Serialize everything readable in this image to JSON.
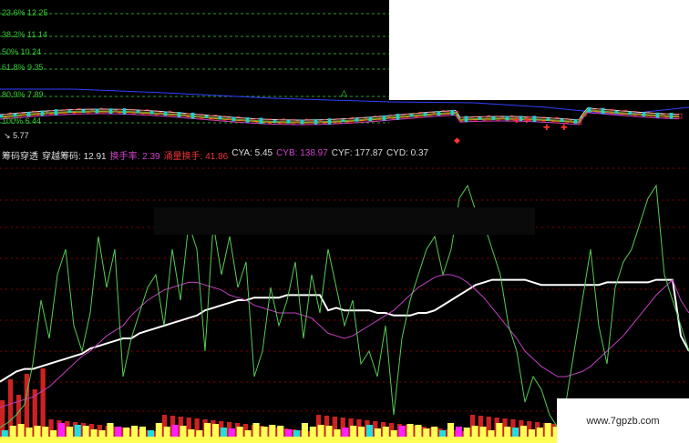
{
  "fib_levels": [
    {
      "label": "23.6% 12.25"
    },
    {
      "label": "38.2% 11.14"
    },
    {
      "label": "50% 10.24"
    },
    {
      "label": "61.8% 9.35"
    },
    {
      "label": "80.9% 7.89"
    },
    {
      "label": "100% 6.44"
    }
  ],
  "low_price_label": "5.77",
  "indicator_header": {
    "name": "筹码穿透",
    "series": [
      {
        "label": "穿越筹码",
        "value": "12.91",
        "color": "#dddddd"
      },
      {
        "label": "换手率",
        "value": "2.39",
        "color": "#cc44cc"
      },
      {
        "label": "涌量换手",
        "value": "41.86",
        "color": "#ee3333"
      },
      {
        "label": "CYA",
        "value": "5.45",
        "color": "#dddddd"
      },
      {
        "label": "CYB",
        "value": "138.97",
        "color": "#cc44cc"
      },
      {
        "label": "CYF",
        "value": "177.87",
        "color": "#dddddd"
      },
      {
        "label": "CYD",
        "value": "0.37",
        "color": "#dddddd"
      }
    ]
  },
  "watermark": "www.7gpzb.com",
  "colors": {
    "background": "#000000",
    "grid": "#8b0000",
    "fib_line": "#2e9e2e",
    "green_line": "#55cc55",
    "white_line": "#ffffff",
    "magenta_line": "#c040c0",
    "bar_red": "#cc2222",
    "bar_yellow": "#ffff55",
    "bar_cyan": "#22dddd",
    "bar_magenta": "#ff22ff"
  },
  "chart_data": {
    "type": "line",
    "series": [
      {
        "name": "穿越筹码",
        "color": "#ffffff",
        "y": [
          18,
          20,
          22,
          23,
          23,
          24,
          25,
          26,
          27,
          28,
          29,
          31,
          32,
          33,
          34,
          35,
          35,
          37,
          38,
          39,
          40,
          41,
          42,
          43,
          44,
          46,
          47,
          48,
          49,
          50,
          50,
          51,
          51,
          51,
          51,
          52,
          52,
          52,
          52,
          52,
          46,
          47,
          46,
          46,
          46,
          46,
          45,
          45,
          44,
          44,
          44,
          45,
          45,
          46,
          48,
          50,
          52,
          54,
          56,
          57,
          58,
          58,
          58,
          58,
          58,
          57,
          56,
          56,
          56,
          56,
          56,
          56,
          56,
          56,
          57,
          57,
          57,
          57,
          57,
          57,
          58,
          58,
          58,
          36,
          30
        ]
      },
      {
        "name": "换手率",
        "color": "#c040c0",
        "y": [
          8,
          9,
          10,
          11,
          12,
          14,
          16,
          19,
          22,
          25,
          28,
          30,
          33,
          36,
          38,
          40,
          44,
          47,
          50,
          52,
          54,
          55,
          56,
          57,
          57,
          56,
          55,
          54,
          52,
          51,
          50,
          48,
          47,
          46,
          45,
          45,
          45,
          44,
          43,
          40,
          37,
          36,
          35,
          36,
          38,
          40,
          42,
          44,
          46,
          49,
          52,
          55,
          57,
          59,
          60,
          60,
          59,
          57,
          54,
          51,
          47,
          43,
          39,
          35,
          30,
          27,
          24,
          22,
          20,
          20,
          21,
          22,
          24,
          27,
          30,
          33,
          36,
          40,
          44,
          48,
          52,
          55,
          58,
          50,
          45
        ]
      },
      {
        "name": "CYA",
        "color": "#55cc55",
        "y": [
          0,
          2,
          5,
          9,
          25,
          50,
          35,
          60,
          70,
          40,
          30,
          45,
          75,
          55,
          70,
          20,
          35,
          45,
          55,
          60,
          40,
          70,
          50,
          80,
          70,
          30,
          80,
          60,
          75,
          55,
          65,
          20,
          30,
          55,
          40,
          50,
          65,
          35,
          60,
          45,
          70,
          55,
          40,
          50,
          25,
          30,
          20,
          40,
          5,
          35,
          50,
          60,
          70,
          75,
          60,
          70,
          90,
          95,
          85,
          80,
          70,
          60,
          40,
          30,
          10,
          20,
          15,
          5,
          0,
          10,
          30,
          50,
          70,
          40,
          25,
          55,
          65,
          70,
          80,
          90,
          95,
          60,
          50,
          40,
          30
        ]
      }
    ],
    "bars": [
      1,
      1,
      2,
      1,
      2,
      2,
      1,
      2,
      1,
      2,
      2,
      1,
      1,
      2,
      1,
      1,
      2,
      2,
      1,
      2,
      1,
      2,
      2,
      1,
      1,
      2,
      2,
      1,
      1,
      2,
      1,
      2,
      1,
      2,
      2,
      1,
      1,
      2,
      1,
      2,
      2,
      1,
      2,
      1,
      1,
      2,
      1,
      2,
      1,
      1,
      2,
      2,
      1,
      2,
      1,
      2,
      1,
      1,
      2,
      2,
      1,
      2,
      1,
      1,
      2,
      1,
      2,
      2,
      1,
      2,
      1,
      1,
      2,
      1,
      2,
      1,
      2,
      2,
      1,
      1,
      2,
      1,
      2,
      1,
      2
    ]
  }
}
